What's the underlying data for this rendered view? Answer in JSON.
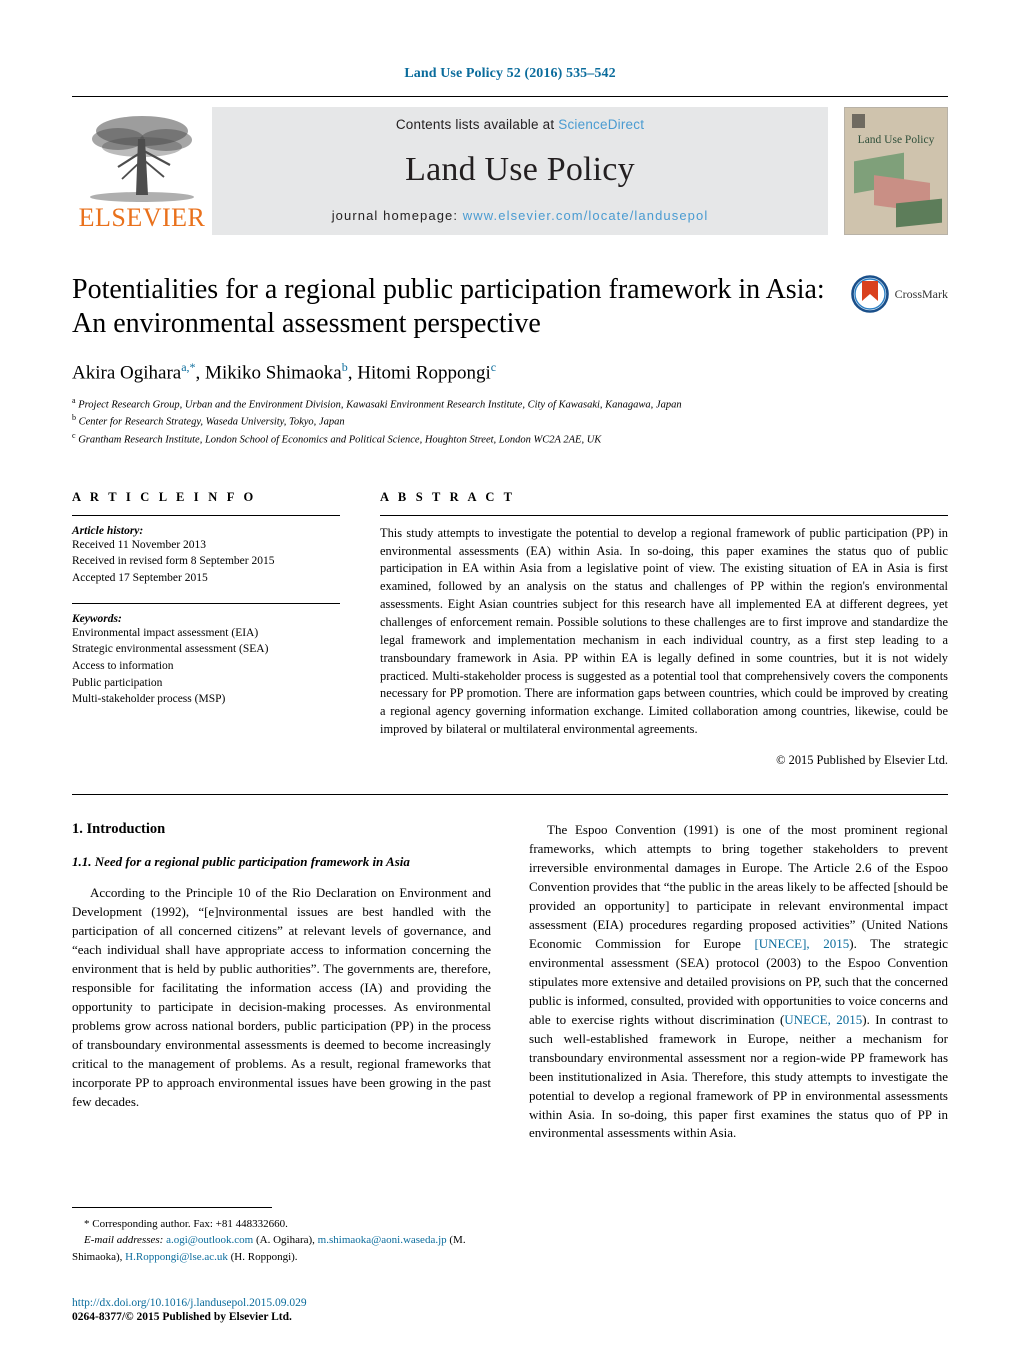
{
  "running_head": "Land Use Policy 52 (2016) 535–542",
  "masthead": {
    "elsevier_wordmark": "ELSEVIER",
    "contents_prefix": "Contents lists available at ",
    "contents_link": "ScienceDirect",
    "journal_title": "Land Use Policy",
    "homepage_prefix": "journal homepage: ",
    "homepage_url": "www.elsevier.com/locate/landusepol",
    "cover_title": "Land Use Policy",
    "link_color": "#4a9bd1",
    "elsevier_orange": "#E9711C",
    "panel_gray": "#e6e7e8"
  },
  "article": {
    "title": "Potentialities for a regional public participation framework in Asia: An environmental assessment perspective",
    "crossmark_label": "CrossMark",
    "authors_html": "Akira Ogihara<sup>a,*</sup>, Mikiko Shimaoka<sup>b</sup>, Hitomi Roppongi<sup>c</sup>",
    "affiliations": [
      "Project Research Group, Urban and the Environment Division, Kawasaki Environment Research Institute, City of Kawasaki, Kanagawa, Japan",
      "Center for Research Strategy, Waseda University, Tokyo, Japan",
      "Grantham Research Institute, London School of Economics and Political Science, Houghton Street, London WC2A 2AE, UK"
    ],
    "affiliation_marks": [
      "a",
      "b",
      "c"
    ]
  },
  "article_info": {
    "heading": "A R T I C L E   I N F O",
    "history_label": "Article history:",
    "history": [
      "Received 11 November 2013",
      "Received in revised form 8 September 2015",
      "Accepted 17 September 2015"
    ],
    "keywords_label": "Keywords:",
    "keywords": [
      "Environmental impact assessment (EIA)",
      "Strategic environmental assessment (SEA)",
      "Access to information",
      "Public participation",
      "Multi-stakeholder process (MSP)"
    ]
  },
  "abstract": {
    "heading": "A B S T R A C T",
    "text": "This study attempts to investigate the potential to develop a regional framework of public participation (PP) in environmental assessments (EA) within Asia. In so-doing, this paper examines the status quo of public participation in EA within Asia from a legislative point of view. The existing situation of EA in Asia is first examined, followed by an analysis on the status and challenges of PP within the region's environmental assessments. Eight Asian countries subject for this research have all implemented EA at different degrees, yet challenges of enforcement remain. Possible solutions to these challenges are to first improve and standardize the legal framework and implementation mechanism in each individual country, as a first step leading to a transboundary framework in Asia. PP within EA is legally defined in some countries, but it is not widely practiced. Multi-stakeholder process is suggested as a potential tool that comprehensively covers the components necessary for PP promotion. There are information gaps between countries, which could be improved by creating a regional agency governing information exchange. Limited collaboration among countries, likewise, could be improved by bilateral or multilateral environmental agreements.",
    "copyright": "© 2015 Published by Elsevier Ltd."
  },
  "body": {
    "section_number_title": "1.  Introduction",
    "subsection_number_title": "1.1.  Need for a regional public participation framework in Asia",
    "left_paragraphs": [
      "According to the Principle 10 of the Rio Declaration on Environment and Development (1992), “[e]nvironmental issues are best handled with the participation of all concerned citizens” at relevant levels of governance, and “each individual shall have appropriate access to information concerning the environment that is held by public authorities”. The governments are, therefore, responsible for facilitating the information access (IA) and providing the opportunity to participate in decision-making processes. As environmental problems grow across national borders, public participation (PP) in the process of transboundary environmental assessments is deemed to become increasingly critical to the management of problems. As a result, regional frameworks that incorporate PP to approach environmental issues have been growing in the past few decades."
    ],
    "right_paragraph_part1": "The Espoo Convention (1991) is one of the most prominent regional frameworks, which attempts to bring together stakeholders to prevent irreversible environmental damages in Europe. The Article 2.6 of the Espoo Convention provides that “the public in the areas likely to be affected [should be provided an opportunity] to participate in relevant environmental impact assessment (EIA) procedures regarding proposed activities” (United Nations Economic Commission for Europe ",
    "right_citation1": "[UNECE], 2015",
    "right_paragraph_part2": "). The strategic environmental assessment (SEA) protocol (2003) to the Espoo Convention stipulates more extensive and detailed provisions on PP, such that the concerned public is informed, consulted, provided with opportunities to voice concerns and able to exercise rights without discrimination (",
    "right_citation2": "UNECE, 2015",
    "right_paragraph_part3": "). In contrast to such well-established framework in Europe, neither a mechanism for transboundary environmental assessment nor a region-wide PP framework has been institutionalized in Asia. Therefore, this study attempts to investigate the potential to develop a regional framework of PP in environmental assessments within Asia. In so-doing, this paper first examines the status quo of PP in environmental assessments within Asia."
  },
  "footnotes": {
    "corresponding": "*  Corresponding author. Fax: +81 448332660.",
    "email_label": "E-mail addresses:",
    "email1": "a.ogi@outlook.com",
    "email1_owner": "(A. Ogihara),",
    "email2": "m.shimaoka@aoni.waseda.jp",
    "email2_owner": "(M. Shimaoka),",
    "email3": "H.Roppongi@lse.ac.uk",
    "email3_owner": "(H. Roppongi)."
  },
  "footer": {
    "doi": "http://dx.doi.org/10.1016/j.landusepol.2015.09.029",
    "issn_line": "0264-8377/© 2015 Published by Elsevier Ltd."
  }
}
